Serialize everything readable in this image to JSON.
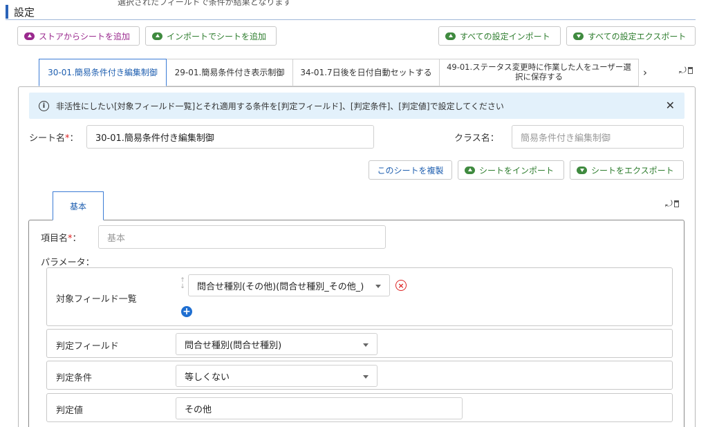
{
  "top_text": "選択されたフィールドで条件が結果となります",
  "section": {
    "title": "設定"
  },
  "toolbar": {
    "add_from_store": "ストアからシートを追加",
    "add_by_import": "インポートでシートを追加",
    "import_all": "すべての設定インポート",
    "export_all": "すべての設定エクスポート"
  },
  "sheet_tabs": [
    {
      "label": "30-01.簡易条件付き編集制御",
      "active": true
    },
    {
      "label": "29-01.簡易条件付き表示制御",
      "active": false
    },
    {
      "label": "34-01.7日後を日付自動セットする",
      "active": false
    },
    {
      "label": "49-01.ステータス変更時に作業した人をユーザー選択に保存する",
      "active": false
    }
  ],
  "info": {
    "message": "非活性にしたい[対象フィールド一覧]とそれ適用する条件を[判定フィールド]、[判定条件]、[判定値]で設定してください"
  },
  "sheet": {
    "name_label": "シート名",
    "name_value": "30-01.簡易条件付き編集制御",
    "class_label": "クラス名：",
    "class_placeholder": "簡易条件付き編集制御",
    "required_mark": "*",
    "colon": "："
  },
  "sheet_actions": {
    "duplicate": "このシートを複製",
    "import": "シートをインポート",
    "export": "シートをエクスポート"
  },
  "item_tabs": [
    {
      "label": "基本",
      "active": true
    }
  ],
  "item": {
    "name_label": "項目名",
    "name_placeholder": "基本",
    "params_label": "パラメータ："
  },
  "params": {
    "target_fields": {
      "label": "対象フィールド一覧",
      "values": [
        "問合せ種別(その他)(問合せ種別_その他_)"
      ]
    },
    "judge_field": {
      "label": "判定フィールド",
      "value": "問合せ種別(問合せ種別)"
    },
    "judge_condition": {
      "label": "判定条件",
      "value": "等しくない"
    },
    "judge_value": {
      "label": "判定値",
      "value": "その他"
    }
  },
  "colors": {
    "accent": "#1f5fb0",
    "purple": "#9a2a8e",
    "green": "#3f8a3f",
    "info_bg": "#e3f1fb",
    "danger": "#d22222"
  }
}
